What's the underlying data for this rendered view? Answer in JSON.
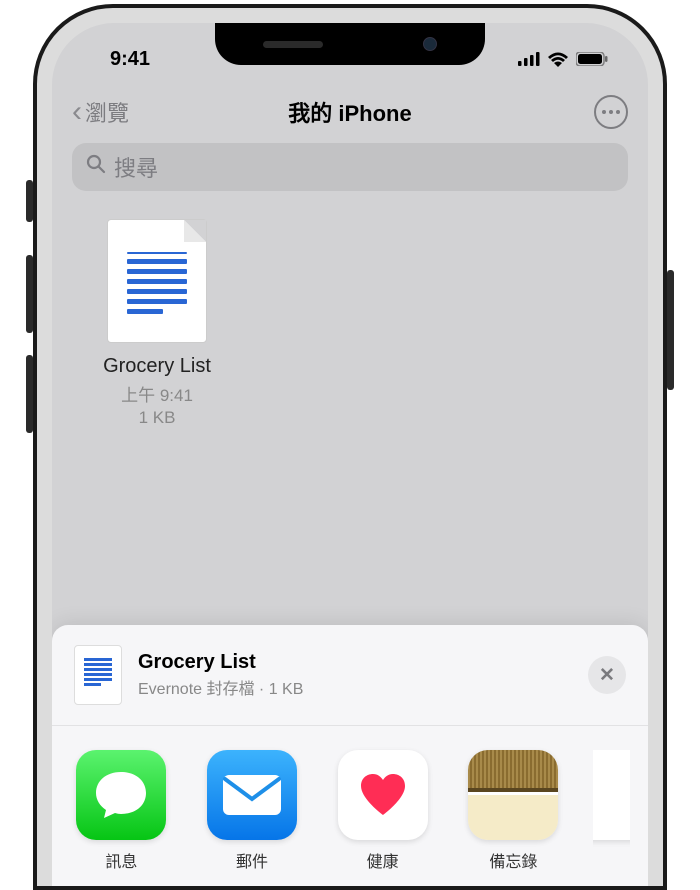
{
  "statusBar": {
    "time": "9:41"
  },
  "nav": {
    "back": "瀏覽",
    "title": "我的 iPhone"
  },
  "search": {
    "placeholder": "搜尋"
  },
  "file": {
    "name": "Grocery List",
    "time": "上午 9:41",
    "size": "1 KB"
  },
  "share": {
    "name": "Grocery List",
    "meta": "Evernote 封存檔 · 1 KB"
  },
  "apps": {
    "messages": "訊息",
    "mail": "郵件",
    "health": "健康",
    "notes": "備忘錄"
  }
}
